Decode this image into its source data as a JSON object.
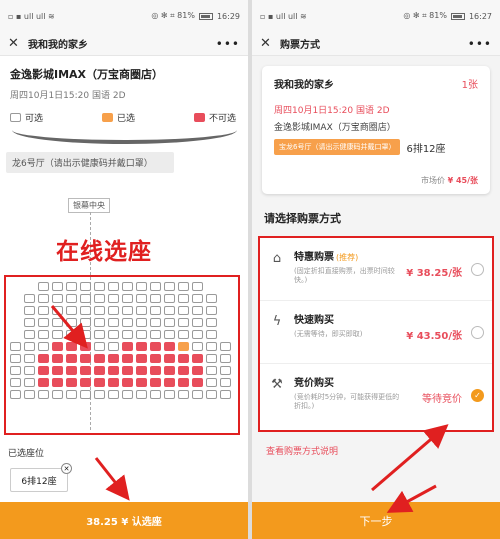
{
  "left": {
    "status": {
      "left": "▫ ▪ ull ull ≋",
      "right": "◎ ✻ ⌗ 81%",
      "time": "16:29"
    },
    "title": "我和我的家乡",
    "cinema_name": "金逸影城IMAX（万宝商圈店）",
    "showtime": "周四10月1日15:20  国语 2D",
    "legend": {
      "available": "可选",
      "sold": "已选",
      "not_for_sale": "不可选"
    },
    "hall": "龙6号厅（请出示健康码并戴口罩）",
    "screen_center": "银幕中央",
    "overlay_title": "在线选座",
    "selected_label": "已选座位",
    "selected_seat": "6排12座",
    "confirm_button": "38.25 ¥ 认选座"
  },
  "right": {
    "status": {
      "left": "▫ ▪ ull ull ≋",
      "right": "◎ ✻ ⌗ 81%",
      "time": "16:27"
    },
    "title": "购票方式",
    "card": {
      "movie": "我和我的家乡",
      "count": "1张",
      "time": "周四10月1日15:20 国语 2D",
      "cinema": "金逸影城IMAX（万宝商圈店）",
      "hall": "宝龙6号厅（请出示健康码并戴口罩）",
      "seat": "6排12座",
      "market_label": "市场价",
      "market_price": "¥ 45/张"
    },
    "choose_title": "请选择购票方式",
    "methods": [
      {
        "name": "特惠购票",
        "tag": "(推荐)",
        "desc": "(固定折扣直接购票，出票时间较快。)",
        "price": "¥ 38.25/张",
        "icon": "discount-tag-icon",
        "selected": false
      },
      {
        "name": "快速购买",
        "tag": "",
        "desc": "(无需等待，即买即取)",
        "price": "¥ 43.50/张",
        "icon": "lightning-icon",
        "selected": false
      },
      {
        "name": "竞价购买",
        "tag": "",
        "desc": "(竞价耗时5分钟，可能获得更低的折扣。)",
        "price": "等待竞价",
        "icon": "auction-hammer-icon",
        "selected": true
      }
    ],
    "explain_link": "查看购票方式说明",
    "next_button": "下一步"
  },
  "colors": {
    "accent": "#f39a1d",
    "red": "#e84d5b",
    "annotation": "#e02020"
  }
}
